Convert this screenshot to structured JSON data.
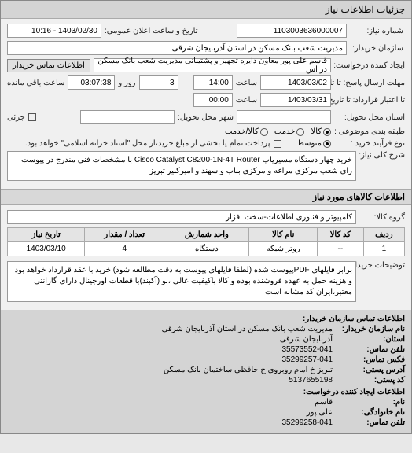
{
  "titlebar": "جزئیات اطلاعات نیاز",
  "form": {
    "ref_label": "شماره نیاز:",
    "ref_value": "1103003636000007",
    "pubdate_label": "تاریخ و ساعت اعلان عمومی:",
    "pubdate_value": "1403/02/30 - 10:16",
    "buyer_label": "سازمان خریدار:",
    "buyer_value": "مدیریت شعب بانک مسکن در استان آذربایجان شرقی",
    "requester_label": "ایجاد کننده درخواست:",
    "requester_value": "قاسم علی پور معاون دایره تجهیز و پشتیبانی مدیریت شعب بانک مسکن در اس",
    "contact_btn": "اطلاعات تماس خریدار",
    "deadline_label": "مهلت ارسال پاسخ: تا تاریخ",
    "deadline_date": "1403/03/02",
    "time_label": "ساعت",
    "deadline_time": "14:00",
    "days_remain": "3",
    "days_remain_label": "روز و",
    "time_remain": "03:07:38",
    "time_remain_label": "ساعت باقی مانده",
    "validity_label": "تا اعتبار قرارداد: تا تاریخ",
    "validity_date": "1403/03/31",
    "validity_time": "00:00",
    "state_label": "استان محل تحویل:",
    "city_label": "شهر محل تحویل:",
    "part_label": "جزئی",
    "budget_type_label": "طبقه بندی موضوعی :",
    "budget_opt1": "کالا",
    "budget_opt2": "خدمت",
    "budget_opt3": "کالا/خدمت",
    "purchase_type_label": "نوع فرآیند خرید :",
    "purchase_opt1": "متوسط",
    "purchase_note": "پرداخت تمام یا بخشی از مبلغ خرید،از محل \"اسناد خزانه اسلامی\" خواهد بود.",
    "desc_label": "شرح کلی نیاز:",
    "desc_value": "خرید چهار دستگاه مسیریاب Cisco Catalyst C8200-1N-4T Router با مشخصات فنی مندرج در پیوست رای شعب مرکزی مراغه و مرکزی بناب و سهند و امیرکبیر تبریز"
  },
  "goods_section": "اطلاعات کالاهای مورد نیاز",
  "group_label": "گروه کالا:",
  "group_value": "کامپیوتر و فناوری اطلاعات-سخت افزار",
  "table": {
    "headers": [
      "ردیف",
      "کد کالا",
      "نام کالا",
      "واحد شمارش",
      "تعداد / مقدار",
      "تاریخ نیاز"
    ],
    "rows": [
      [
        "1",
        "--",
        "روتر شبکه",
        "دستگاه",
        "4",
        "1403/03/10"
      ]
    ]
  },
  "buyer_notes_label": "توضیحات خریدار:",
  "buyer_notes_value": "برابر فایلهای PDFپیوست شده (لطفا فایلهای پیوست به دقت مطالعه شود) خرید با عقد قرارداد خواهد بود و هزینه حمل به عهده فروشنده بوده و کالا باکیفیت عالی ،نو (آکبند)با قطعات اورجینال دارای گارانتی معتبر،ایران کد مشابه است",
  "contact": {
    "header": "اطلاعات تماس سازمان خریدار:",
    "org_label": "نام سازمان خریدار:",
    "org_value": "مدیریت شعب بانک مسکن در استان آذربایجان شرقی",
    "province_label": "استان:",
    "province_value": "آذربایجان شرقی",
    "phone_label": "تلفن تماس:",
    "phone_value": "35573552-041",
    "fax_label": "فکس تماس:",
    "fax_value": "35299257-041",
    "address_label": "آدرس پستی:",
    "address_value": "تبریز خ امام روبروی خ حافظی ساختمان بانک مسکن",
    "postal_label": "کد پستی:",
    "postal_value": "5137655198",
    "creator_header": "اطلاعات ایجاد کننده درخواست:",
    "name_label": "نام:",
    "name_value": "قاسم",
    "family_label": "نام خانوادگی:",
    "family_value": "علی پور",
    "cphone_label": "تلفن تماس:",
    "cphone_value": "35299258-041"
  }
}
